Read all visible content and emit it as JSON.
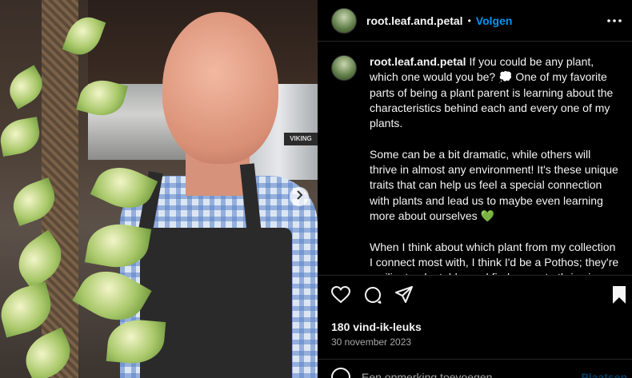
{
  "post": {
    "username": "root.leaf.and.petal",
    "follow_label": "Volgen",
    "separator": "•",
    "image_sign": "VIKING"
  },
  "caption": {
    "username": "root.leaf.and.petal",
    "paragraph1": "If you could be any plant, which one would you be? 💭 One of my favorite parts of being a plant parent is learning about the characteristics behind each and every one of my plants.",
    "paragraph2": "Some can be a bit dramatic, while others will thrive in almost any environment! It's these unique traits that can help us feel a special connection with plants and lead us to maybe even learning more about ourselves 💚",
    "paragraph3": "When I think about which plant from my collection I connect most with, I think I'd be a Pothos; they're resilient, adaptable, and find a way to thrive in almost any environment."
  },
  "stats": {
    "likes": "180 vind-ik-leuks",
    "date": "30 november 2023"
  },
  "comment": {
    "placeholder": "Een opmerking toevoegen...",
    "post_label": "Plaatsen"
  },
  "icons": {
    "more": "more-horizontal-icon",
    "like": "heart-icon",
    "comment": "comment-icon",
    "share": "send-icon",
    "save": "bookmark-icon",
    "next": "chevron-right-icon",
    "emoji": "emoji-icon"
  },
  "colors": {
    "accent": "#0095f6",
    "background": "#000000",
    "text": "#f5f5f5",
    "secondary": "#a8a8a8"
  }
}
